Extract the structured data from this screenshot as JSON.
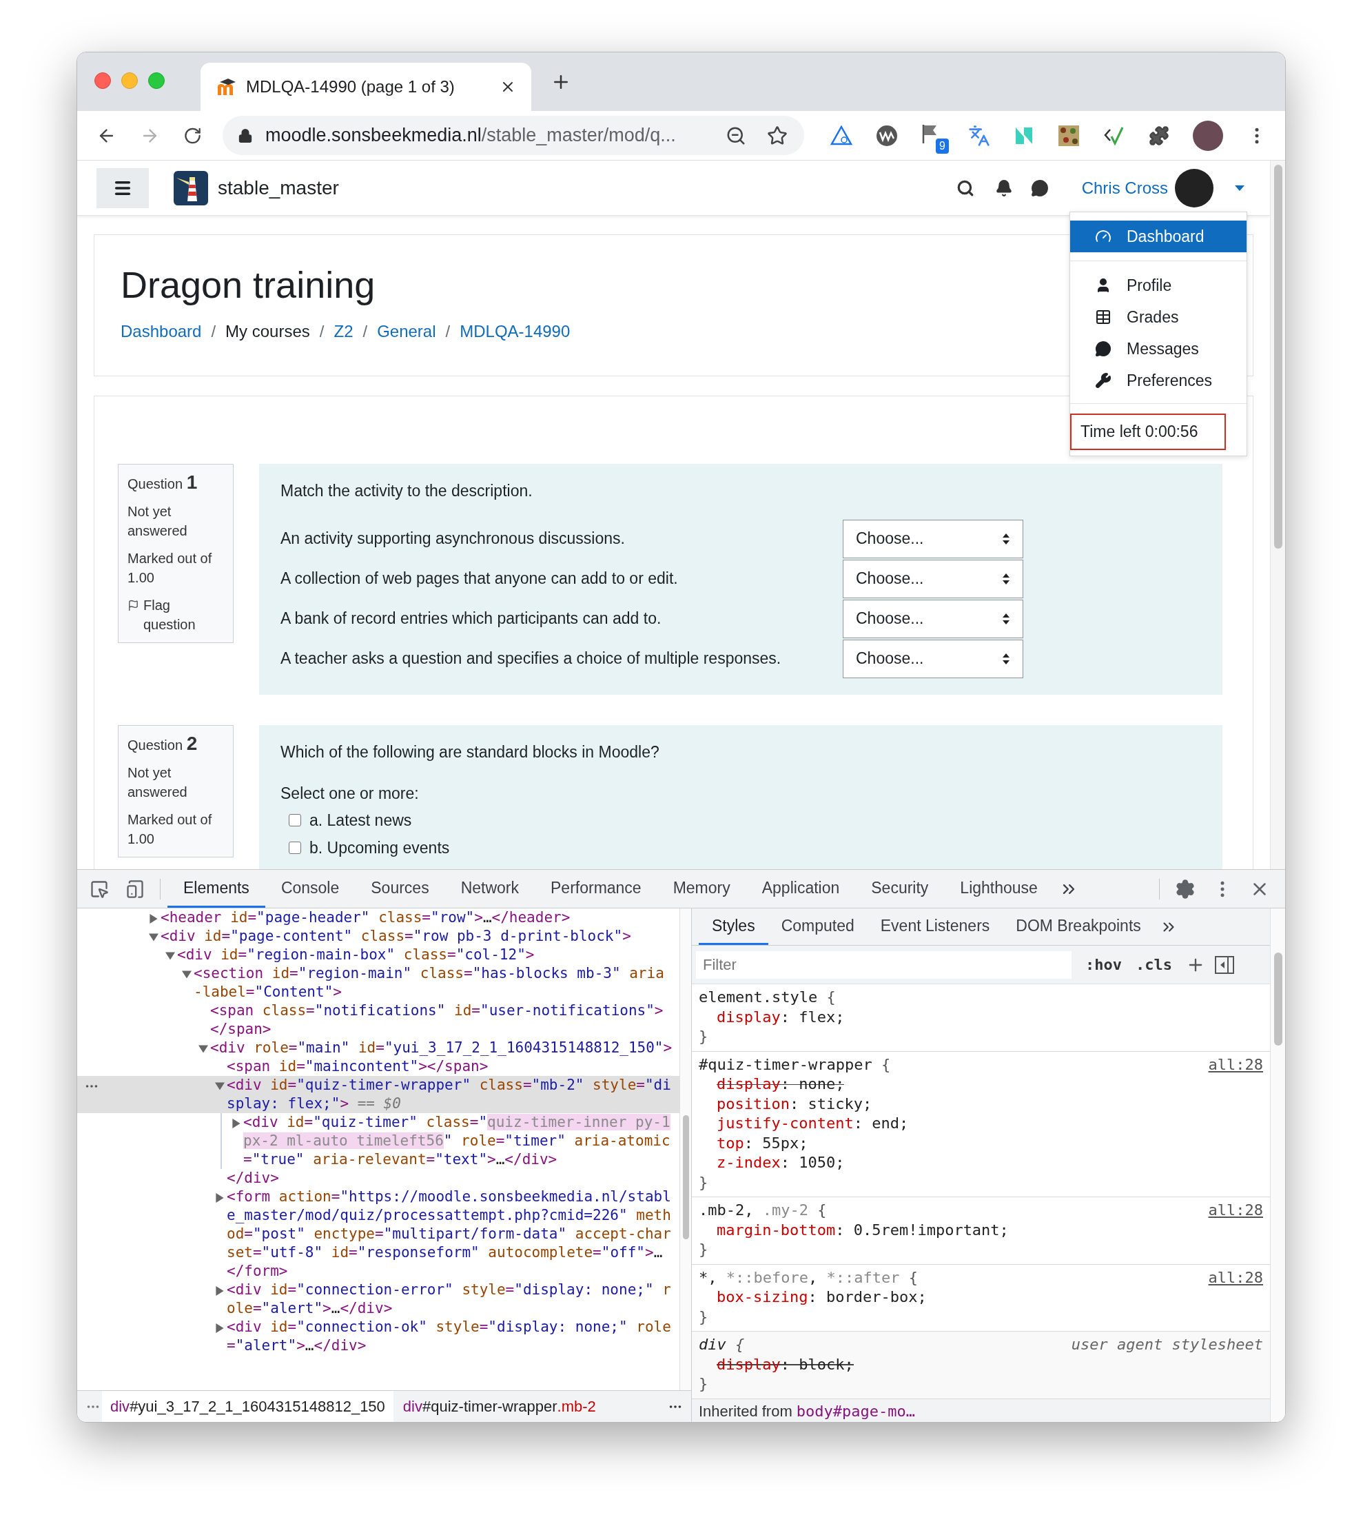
{
  "browser": {
    "tab": {
      "title": "MDLQA-14990 (page 1 of 3)"
    },
    "address": {
      "host": "moodle.sonsbeekmedia.nl",
      "path": "/stable_master/mod/q..."
    },
    "extension_badge": "9"
  },
  "site": {
    "name": "stable_master",
    "user": "Chris Cross"
  },
  "user_menu": {
    "items": [
      {
        "label": "Dashboard",
        "selected": true,
        "kind": "dashboard"
      },
      {
        "label": "Profile",
        "selected": false,
        "kind": "profile"
      },
      {
        "label": "Grades",
        "selected": false,
        "kind": "grades"
      },
      {
        "label": "Messages",
        "selected": false,
        "kind": "messages"
      },
      {
        "label": "Preferences",
        "selected": false,
        "kind": "preferences"
      }
    ],
    "timer": "Time left 0:00:56"
  },
  "page_header": {
    "title": "Dragon training",
    "breadcrumb": [
      {
        "label": "Dashboard",
        "link": true,
        "separator": "/"
      },
      {
        "label": "My courses",
        "link": false,
        "separator": "/"
      },
      {
        "label": "Z2",
        "link": true,
        "separator": "/"
      },
      {
        "label": "General",
        "link": true,
        "separator": "/"
      },
      {
        "label": "MDLQA-14990",
        "link": true
      }
    ]
  },
  "questions": [
    {
      "kind": "match",
      "label": "Question",
      "number": "1",
      "state": "Not yet answered",
      "marks": "Marked out of 1.00",
      "flag": "Flag question",
      "prompt": "Match the activity to the description.",
      "rows": [
        {
          "text": "An activity supporting asynchronous discussions.",
          "choice": "Choose..."
        },
        {
          "text": "A collection of web pages that anyone can add to or edit.",
          "choice": "Choose..."
        },
        {
          "text": "A bank of record entries which participants can add to.",
          "choice": "Choose..."
        },
        {
          "text": "A teacher asks a question and specifies a choice of multiple responses.",
          "choice": "Choose..."
        }
      ]
    },
    {
      "kind": "multichoice",
      "label": "Question",
      "number": "2",
      "state": "Not yet answered",
      "marks": "Marked out of 1.00",
      "prompt": "Which of the following are standard blocks in Moodle?",
      "instruction": "Select one or more:",
      "options": [
        {
          "label": "a. Latest news",
          "checked": false
        },
        {
          "label": "b. Upcoming events",
          "checked": false
        }
      ]
    }
  ],
  "devtools": {
    "tabs": [
      {
        "label": "Elements",
        "selected": true
      },
      {
        "label": "Console",
        "selected": false
      },
      {
        "label": "Sources",
        "selected": false
      },
      {
        "label": "Network",
        "selected": false
      },
      {
        "label": "Performance",
        "selected": false
      },
      {
        "label": "Memory",
        "selected": false
      },
      {
        "label": "Application",
        "selected": false
      },
      {
        "label": "Security",
        "selected": false
      },
      {
        "label": "Lighthouse",
        "selected": false
      }
    ],
    "dom_tree": [
      {
        "expanded": false,
        "selected": false,
        "code": [
          {
            "kind": "tag",
            "text": "<header"
          },
          {
            "kind": "attr",
            "text": " id"
          },
          {
            "kind": "tag",
            "text": "="
          },
          {
            "kind": "val",
            "text": "\"page-header\""
          },
          {
            "kind": "attr",
            "text": " class"
          },
          {
            "kind": "tag",
            "text": "="
          },
          {
            "kind": "val",
            "text": "\"row\""
          },
          {
            "kind": "tag",
            "text": ">"
          },
          {
            "kind": "text",
            "text": "…"
          },
          {
            "kind": "tag",
            "text": "</header>"
          }
        ]
      },
      {
        "expanded": true,
        "selected": false,
        "code": [
          {
            "kind": "tag",
            "text": "<div"
          },
          {
            "kind": "attr",
            "text": " id"
          },
          {
            "kind": "tag",
            "text": "="
          },
          {
            "kind": "val",
            "text": "\"page-content\""
          },
          {
            "kind": "attr",
            "text": " class"
          },
          {
            "kind": "tag",
            "text": "="
          },
          {
            "kind": "val",
            "text": "\"row pb-3 d-print-block\""
          },
          {
            "kind": "tag",
            "text": ">"
          }
        ],
        "children": [
          {
            "expanded": true,
            "selected": false,
            "code": [
              {
                "kind": "tag",
                "text": "<div"
              },
              {
                "kind": "attr",
                "text": " id"
              },
              {
                "kind": "tag",
                "text": "="
              },
              {
                "kind": "val",
                "text": "\"region-main-box\""
              },
              {
                "kind": "attr",
                "text": " class"
              },
              {
                "kind": "tag",
                "text": "="
              },
              {
                "kind": "val",
                "text": "\"col-12\""
              },
              {
                "kind": "tag",
                "text": ">"
              }
            ],
            "children": [
              {
                "expanded": true,
                "selected": false,
                "code": [
                  {
                    "kind": "tag",
                    "text": "<section"
                  },
                  {
                    "kind": "attr",
                    "text": " id"
                  },
                  {
                    "kind": "tag",
                    "text": "="
                  },
                  {
                    "kind": "val",
                    "text": "\"region-main\""
                  },
                  {
                    "kind": "attr",
                    "text": " class"
                  },
                  {
                    "kind": "tag",
                    "text": "="
                  },
                  {
                    "kind": "val",
                    "text": "\"has-blocks mb-3\""
                  },
                  {
                    "kind": "attr",
                    "text": " aria-label"
                  },
                  {
                    "kind": "tag",
                    "text": "="
                  },
                  {
                    "kind": "val",
                    "text": "\"Content\""
                  },
                  {
                    "kind": "tag",
                    "text": ">"
                  }
                ],
                "children": [
                  {
                    "selected": false,
                    "code": [
                      {
                        "kind": "tag",
                        "text": "<span"
                      },
                      {
                        "kind": "attr",
                        "text": " class"
                      },
                      {
                        "kind": "tag",
                        "text": "="
                      },
                      {
                        "kind": "val",
                        "text": "\"notifications\""
                      },
                      {
                        "kind": "attr",
                        "text": " id"
                      },
                      {
                        "kind": "tag",
                        "text": "="
                      },
                      {
                        "kind": "val",
                        "text": "\"user-notifications\""
                      },
                      {
                        "kind": "tag",
                        "text": "></span>"
                      }
                    ]
                  },
                  {
                    "expanded": true,
                    "selected": false,
                    "code": [
                      {
                        "kind": "tag",
                        "text": "<div"
                      },
                      {
                        "kind": "attr",
                        "text": " role"
                      },
                      {
                        "kind": "tag",
                        "text": "="
                      },
                      {
                        "kind": "val",
                        "text": "\"main\""
                      },
                      {
                        "kind": "attr",
                        "text": " id"
                      },
                      {
                        "kind": "tag",
                        "text": "="
                      },
                      {
                        "kind": "val",
                        "text": "\"yui_3_17_2_1_1604315148812_150\""
                      },
                      {
                        "kind": "tag",
                        "text": ">"
                      }
                    ],
                    "children": [
                      {
                        "selected": false,
                        "code": [
                          {
                            "kind": "tag",
                            "text": "<span"
                          },
                          {
                            "kind": "attr",
                            "text": " id"
                          },
                          {
                            "kind": "tag",
                            "text": "="
                          },
                          {
                            "kind": "val",
                            "text": "\"maincontent\""
                          },
                          {
                            "kind": "tag",
                            "text": "></span>"
                          }
                        ]
                      },
                      {
                        "expanded": true,
                        "selected": true,
                        "code": [
                          {
                            "kind": "tag",
                            "text": "<div"
                          },
                          {
                            "kind": "attr",
                            "text": " id"
                          },
                          {
                            "kind": "tag",
                            "text": "="
                          },
                          {
                            "kind": "val",
                            "text": "\"quiz-timer-wrapper\""
                          },
                          {
                            "kind": "attr",
                            "text": " class"
                          },
                          {
                            "kind": "tag",
                            "text": "="
                          },
                          {
                            "kind": "val",
                            "text": "\"mb-2\""
                          },
                          {
                            "kind": "attr",
                            "text": " style"
                          },
                          {
                            "kind": "tag",
                            "text": "="
                          },
                          {
                            "kind": "val",
                            "text": "\"display: flex;\""
                          },
                          {
                            "kind": "tag",
                            "text": ">"
                          },
                          {
                            "kind": "ref",
                            "text": " == $0"
                          }
                        ],
                        "closing": [
                          {
                            "kind": "tag",
                            "text": "</div>"
                          }
                        ],
                        "children": [
                          {
                            "expanded": false,
                            "selected": false,
                            "code": [
                              {
                                "kind": "tag",
                                "text": "<div"
                              },
                              {
                                "kind": "attr",
                                "text": " id"
                              },
                              {
                                "kind": "tag",
                                "text": "="
                              },
                              {
                                "kind": "val",
                                "text": "\"quiz-timer\""
                              },
                              {
                                "kind": "attr",
                                "text": " class"
                              },
                              {
                                "kind": "tag",
                                "text": "="
                              },
                              {
                                "kind": "val",
                                "text": "\""
                              },
                              {
                                "kind": "hl",
                                "text": "quiz-timer-inner py-1 px-2 ml-auto timeleft56"
                              },
                              {
                                "kind": "val",
                                "text": "\""
                              },
                              {
                                "kind": "attr",
                                "text": " role"
                              },
                              {
                                "kind": "tag",
                                "text": "="
                              },
                              {
                                "kind": "val",
                                "text": "\"timer\""
                              },
                              {
                                "kind": "attr",
                                "text": " aria-atomic"
                              },
                              {
                                "kind": "tag",
                                "text": "="
                              },
                              {
                                "kind": "val",
                                "text": "\"true\""
                              },
                              {
                                "kind": "attr",
                                "text": " aria-relevant"
                              },
                              {
                                "kind": "tag",
                                "text": "="
                              },
                              {
                                "kind": "val",
                                "text": "\"text\""
                              },
                              {
                                "kind": "tag",
                                "text": ">"
                              },
                              {
                                "kind": "text",
                                "text": "…"
                              },
                              {
                                "kind": "tag",
                                "text": "</div>"
                              }
                            ]
                          }
                        ]
                      },
                      {
                        "expanded": false,
                        "selected": false,
                        "code": [
                          {
                            "kind": "tag",
                            "text": "<form"
                          },
                          {
                            "kind": "attr",
                            "text": " action"
                          },
                          {
                            "kind": "tag",
                            "text": "="
                          },
                          {
                            "kind": "val",
                            "text": "\"https://moodle.sonsbeekmedia.nl/stable_master/mod/quiz/processattempt.php?cmid=226\""
                          },
                          {
                            "kind": "attr",
                            "text": " method"
                          },
                          {
                            "kind": "tag",
                            "text": "="
                          },
                          {
                            "kind": "val",
                            "text": "\"post\""
                          },
                          {
                            "kind": "attr",
                            "text": " enctype"
                          },
                          {
                            "kind": "tag",
                            "text": "="
                          },
                          {
                            "kind": "val",
                            "text": "\"multipart/form-data\""
                          },
                          {
                            "kind": "attr",
                            "text": " accept-charset"
                          },
                          {
                            "kind": "tag",
                            "text": "="
                          },
                          {
                            "kind": "val",
                            "text": "\"utf-8\""
                          },
                          {
                            "kind": "attr",
                            "text": " id"
                          },
                          {
                            "kind": "tag",
                            "text": "="
                          },
                          {
                            "kind": "val",
                            "text": "\"responseform\""
                          },
                          {
                            "kind": "attr",
                            "text": " autocomplete"
                          },
                          {
                            "kind": "tag",
                            "text": "="
                          },
                          {
                            "kind": "val",
                            "text": "\"off\""
                          },
                          {
                            "kind": "tag",
                            "text": ">"
                          },
                          {
                            "kind": "text",
                            "text": "…"
                          },
                          {
                            "kind": "tag",
                            "text": "</form>"
                          }
                        ]
                      },
                      {
                        "expanded": false,
                        "selected": false,
                        "code": [
                          {
                            "kind": "tag",
                            "text": "<div"
                          },
                          {
                            "kind": "attr",
                            "text": " id"
                          },
                          {
                            "kind": "tag",
                            "text": "="
                          },
                          {
                            "kind": "val",
                            "text": "\"connection-error\""
                          },
                          {
                            "kind": "attr",
                            "text": " style"
                          },
                          {
                            "kind": "tag",
                            "text": "="
                          },
                          {
                            "kind": "val",
                            "text": "\"display: none;\""
                          },
                          {
                            "kind": "attr",
                            "text": " role"
                          },
                          {
                            "kind": "tag",
                            "text": "="
                          },
                          {
                            "kind": "val",
                            "text": "\"alert\""
                          },
                          {
                            "kind": "tag",
                            "text": ">"
                          },
                          {
                            "kind": "text",
                            "text": "…"
                          },
                          {
                            "kind": "tag",
                            "text": "</div>"
                          }
                        ]
                      },
                      {
                        "expanded": false,
                        "selected": false,
                        "code": [
                          {
                            "kind": "tag",
                            "text": "<div"
                          },
                          {
                            "kind": "attr",
                            "text": " id"
                          },
                          {
                            "kind": "tag",
                            "text": "="
                          },
                          {
                            "kind": "val",
                            "text": "\"connection-ok\""
                          },
                          {
                            "kind": "attr",
                            "text": " style"
                          },
                          {
                            "kind": "tag",
                            "text": "="
                          },
                          {
                            "kind": "val",
                            "text": "\"display: none;\""
                          },
                          {
                            "kind": "attr",
                            "text": " role"
                          },
                          {
                            "kind": "tag",
                            "text": "="
                          },
                          {
                            "kind": "val",
                            "text": "\"alert\""
                          },
                          {
                            "kind": "tag",
                            "text": ">"
                          },
                          {
                            "kind": "text",
                            "text": "…"
                          },
                          {
                            "kind": "tag",
                            "text": "</div>"
                          }
                        ]
                      }
                    ]
                  }
                ]
              }
            ]
          }
        ]
      }
    ],
    "crumbs": [
      [
        {
          "kind": "tag",
          "text": "div"
        },
        {
          "kind": "id",
          "text": "#yui_3_17_2_1_1604315148812_150"
        }
      ],
      [
        {
          "kind": "tag",
          "text": "div"
        },
        {
          "kind": "id",
          "text": "#quiz-timer-wrapper"
        },
        {
          "kind": "cls",
          "text": ".mb-2"
        }
      ]
    ],
    "style_tabs": [
      {
        "label": "Styles",
        "selected": true
      },
      {
        "label": "Computed",
        "selected": false
      },
      {
        "label": "Event Listeners",
        "selected": false
      },
      {
        "label": "DOM Breakpoints",
        "selected": false
      }
    ],
    "filter": {
      "placeholder": "Filter"
    },
    "hov": ":hov",
    "cls": ".cls",
    "rules": [
      {
        "kind": "normal",
        "selector": [
          {
            "kind": "sel",
            "text": "element.style"
          },
          {
            "kind": "brace",
            "text": " {"
          }
        ],
        "close": "}",
        "decls": [
          {
            "struck": false,
            "tokens": [
              {
                "kind": "prop",
                "text": "display"
              },
              {
                "kind": "punct",
                "text": ": "
              },
              {
                "kind": "value",
                "text": "flex;"
              }
            ]
          }
        ]
      },
      {
        "kind": "normal",
        "selector": [
          {
            "kind": "sel",
            "text": "#quiz-timer-wrapper"
          },
          {
            "kind": "brace",
            "text": " {"
          }
        ],
        "source": "all:28",
        "close": "}",
        "decls": [
          {
            "struck": true,
            "tokens": [
              {
                "kind": "prop",
                "text": "display"
              },
              {
                "kind": "punct",
                "text": ": "
              },
              {
                "kind": "value",
                "text": "none;"
              }
            ]
          },
          {
            "struck": false,
            "tokens": [
              {
                "kind": "prop",
                "text": "position"
              },
              {
                "kind": "punct",
                "text": ": "
              },
              {
                "kind": "value",
                "text": "sticky;"
              }
            ]
          },
          {
            "struck": false,
            "tokens": [
              {
                "kind": "prop",
                "text": "justify-content"
              },
              {
                "kind": "punct",
                "text": ": "
              },
              {
                "kind": "value",
                "text": "end;"
              }
            ]
          },
          {
            "struck": false,
            "tokens": [
              {
                "kind": "prop",
                "text": "top"
              },
              {
                "kind": "punct",
                "text": ": "
              },
              {
                "kind": "value",
                "text": "55px;"
              }
            ]
          },
          {
            "struck": false,
            "tokens": [
              {
                "kind": "prop",
                "text": "z-index"
              },
              {
                "kind": "punct",
                "text": ": "
              },
              {
                "kind": "value",
                "text": "1050;"
              }
            ]
          }
        ]
      },
      {
        "kind": "normal",
        "selector": [
          {
            "kind": "sel",
            "text": ".mb-2"
          },
          {
            "kind": "punct",
            "text": ", "
          },
          {
            "kind": "dim",
            "text": ".my-2"
          },
          {
            "kind": "brace",
            "text": " {"
          }
        ],
        "source": "all:28",
        "close": "}",
        "decls": [
          {
            "struck": false,
            "tokens": [
              {
                "kind": "prop",
                "text": "margin-bottom"
              },
              {
                "kind": "punct",
                "text": ": "
              },
              {
                "kind": "value",
                "text": "0.5rem!important;"
              }
            ]
          }
        ]
      },
      {
        "kind": "normal",
        "selector": [
          {
            "kind": "sel",
            "text": "*"
          },
          {
            "kind": "punct",
            "text": ", "
          },
          {
            "kind": "dim",
            "text": "*::before"
          },
          {
            "kind": "punct",
            "text": ", "
          },
          {
            "kind": "dim",
            "text": "*::after"
          },
          {
            "kind": "brace",
            "text": " {"
          }
        ],
        "source": "all:28",
        "close": "}",
        "decls": [
          {
            "struck": false,
            "tokens": [
              {
                "kind": "prop",
                "text": "box-sizing"
              },
              {
                "kind": "punct",
                "text": ": "
              },
              {
                "kind": "value",
                "text": "border-box;"
              }
            ]
          }
        ]
      },
      {
        "kind": "ua",
        "selector": [
          {
            "kind": "sel",
            "text": "div"
          },
          {
            "kind": "brace",
            "text": " {"
          }
        ],
        "source": "user agent stylesheet",
        "close": "}",
        "decls": [
          {
            "struck": true,
            "tokens": [
              {
                "kind": "prop",
                "text": "display"
              },
              {
                "kind": "punct",
                "text": ": "
              },
              {
                "kind": "value",
                "text": "block;"
              }
            ]
          }
        ]
      }
    ],
    "inherited": {
      "label": "Inherited from",
      "link": "body#page-mo…"
    }
  }
}
